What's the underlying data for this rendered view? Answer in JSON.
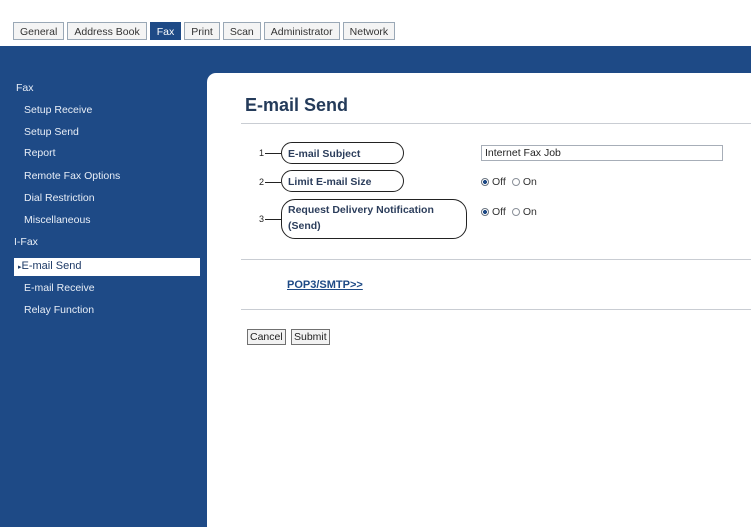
{
  "tabs": [
    {
      "label": "General",
      "active": false
    },
    {
      "label": "Address Book",
      "active": false
    },
    {
      "label": "Fax",
      "active": true
    },
    {
      "label": "Print",
      "active": false
    },
    {
      "label": "Scan",
      "active": false
    },
    {
      "label": "Administrator",
      "active": false
    },
    {
      "label": "Network",
      "active": false
    }
  ],
  "sidebar": {
    "group_fax": "Fax",
    "fax_items": [
      "Setup Receive",
      "Setup Send",
      "Report",
      "Remote Fax Options",
      "Dial Restriction",
      "Miscellaneous"
    ],
    "group_ifax": "I-Fax",
    "selected": "E-mail Send",
    "ifax_items": [
      "E-mail Receive",
      "Relay Function"
    ]
  },
  "page": {
    "title": "E-mail Send",
    "callouts": [
      "1",
      "2",
      "3"
    ],
    "fields": {
      "subject_label": "E-mail Subject",
      "subject_value": "Internet Fax Job",
      "limit_label": "Limit E-mail Size",
      "notify_label_line1": "Request Delivery Notification",
      "notify_label_line2": "(Send)"
    },
    "radio_off": "Off",
    "radio_on": "On",
    "limit_selected": "Off",
    "notify_selected": "Off",
    "link": "POP3/SMTP>>",
    "cancel": "Cancel",
    "submit": "Submit"
  },
  "colors": {
    "brand": "#1e4a86"
  }
}
